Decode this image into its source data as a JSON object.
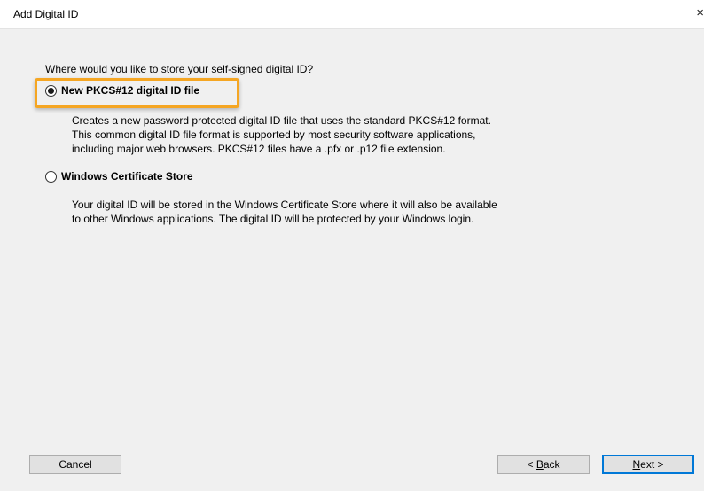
{
  "window": {
    "title": "Add Digital ID",
    "close_glyph": "×"
  },
  "question": "Where would you like to store your self-signed digital ID?",
  "options": [
    {
      "label": "New PKCS#12 digital ID file",
      "selected": true,
      "description": [
        "Creates a new password protected digital ID file that uses the standard PKCS#12 format.",
        "This common digital ID file format is supported by most security software applications,",
        "including major web browsers. PKCS#12 files have a .pfx or .p12 file extension."
      ]
    },
    {
      "label": "Windows Certificate Store",
      "selected": false,
      "description": [
        "Your digital ID will be stored in the Windows Certificate Store where it will also be available",
        "to other Windows applications. The digital ID will be protected by your Windows login."
      ]
    }
  ],
  "buttons": {
    "cancel": "Cancel",
    "back_mnemonic": "B",
    "back_rest": "ack",
    "back_prefix": "< ",
    "next_mnemonic": "N",
    "next_rest": "ext >"
  },
  "colors": {
    "highlight": "#f5a623",
    "default_button_border": "#0078d7"
  }
}
